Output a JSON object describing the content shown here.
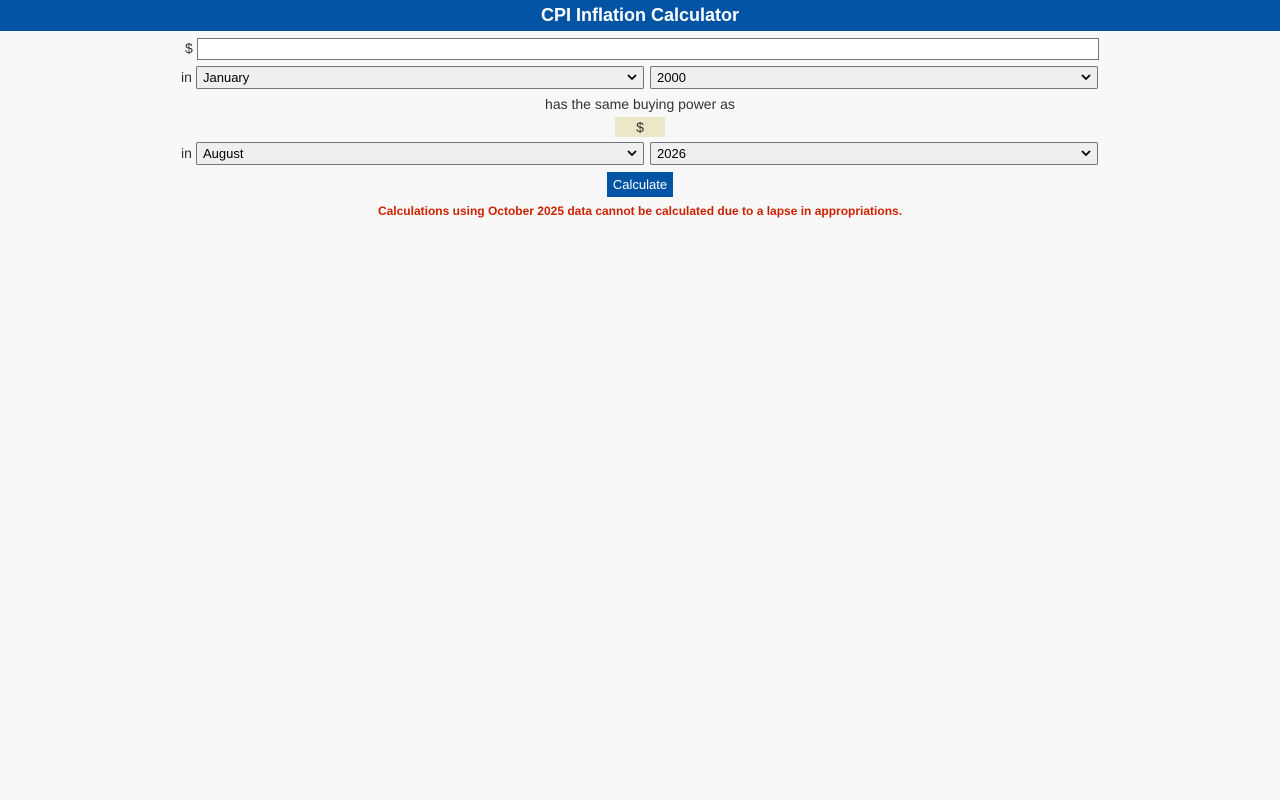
{
  "header": {
    "title": "CPI Inflation Calculator"
  },
  "form": {
    "dollar_sign": "$",
    "amount_value": "",
    "in_label": "in",
    "from_month": "January",
    "from_year": "2000",
    "buying_text": "has the same buying power as",
    "result_text": "$",
    "to_month": "August",
    "to_year": "2026",
    "calculate_label": "Calculate"
  },
  "notice": {
    "text": "Calculations using October 2025 data cannot be calculated due to a lapse in appropriations."
  },
  "colors": {
    "header_bg": "#0054a3",
    "button_bg": "#0054a3",
    "result_bg": "#ede7c9",
    "notice_text": "#cc2200",
    "page_bg": "#f8f8f8"
  }
}
